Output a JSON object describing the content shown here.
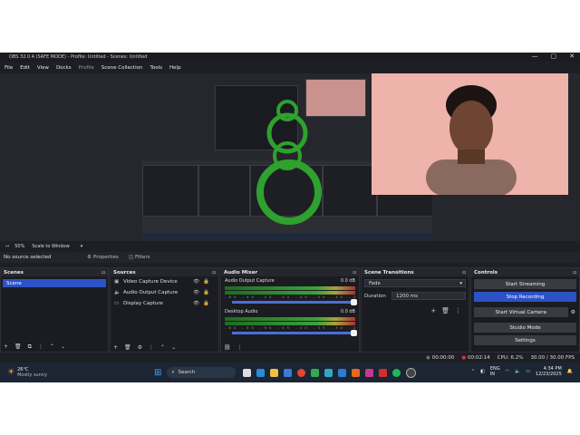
{
  "window": {
    "title": "OBS 32.0.4 (SAFE MODE) - Profile: Untitled - Scenes: Untitled",
    "controls": [
      "—",
      "▢",
      "✕"
    ]
  },
  "menu": [
    "File",
    "Edit",
    "View",
    "Docks",
    "Profile",
    "Scene Collection",
    "Tools",
    "Help"
  ],
  "preview": {
    "zoom": "50%",
    "scale": "Scale to Window"
  },
  "controlbar": {
    "no_source": "No source selected",
    "properties": "Properties",
    "filters": "Filters"
  },
  "scenes": {
    "title": "Scenes",
    "items": [
      "Scene"
    ]
  },
  "sources": {
    "title": "Sources",
    "items": [
      "Video Capture Device",
      "Audio Output Capture",
      "Display Capture"
    ]
  },
  "mixer": {
    "title": "Audio Mixer",
    "channels": [
      {
        "name": "Audio Output Capture",
        "db": "0.0 dB"
      },
      {
        "name": "Desktop Audio",
        "db": "0.0 dB"
      }
    ],
    "ticks": "-60 -55 -50 -45 -40 -35 -30 -25 -20 -15 -10 -5 0"
  },
  "transitions": {
    "title": "Scene Transitions",
    "type": "Fade",
    "duration_label": "Duration",
    "duration": "1200 ms"
  },
  "controls": {
    "title": "Controls",
    "buttons": [
      "Start Streaming",
      "Stop Recording",
      "Start Virtual Camera",
      "Studio Mode",
      "Settings"
    ]
  },
  "status": {
    "stream_time": "00:00:00",
    "rec_time": "00:02:14",
    "cpu": "CPU: 6.2%",
    "fps": "30.00 / 30.00 FPS"
  },
  "taskbar": {
    "weather_temp": "26°C",
    "weather_desc": "Mostly sunny",
    "search": "Search",
    "lang1": "ENG",
    "lang2": "IN",
    "time": "4:34 PM",
    "date": "12/23/2025"
  },
  "colors": {
    "accent": "#2c52c6",
    "panel": "#1b1c21",
    "rec": "#d03a3a"
  }
}
